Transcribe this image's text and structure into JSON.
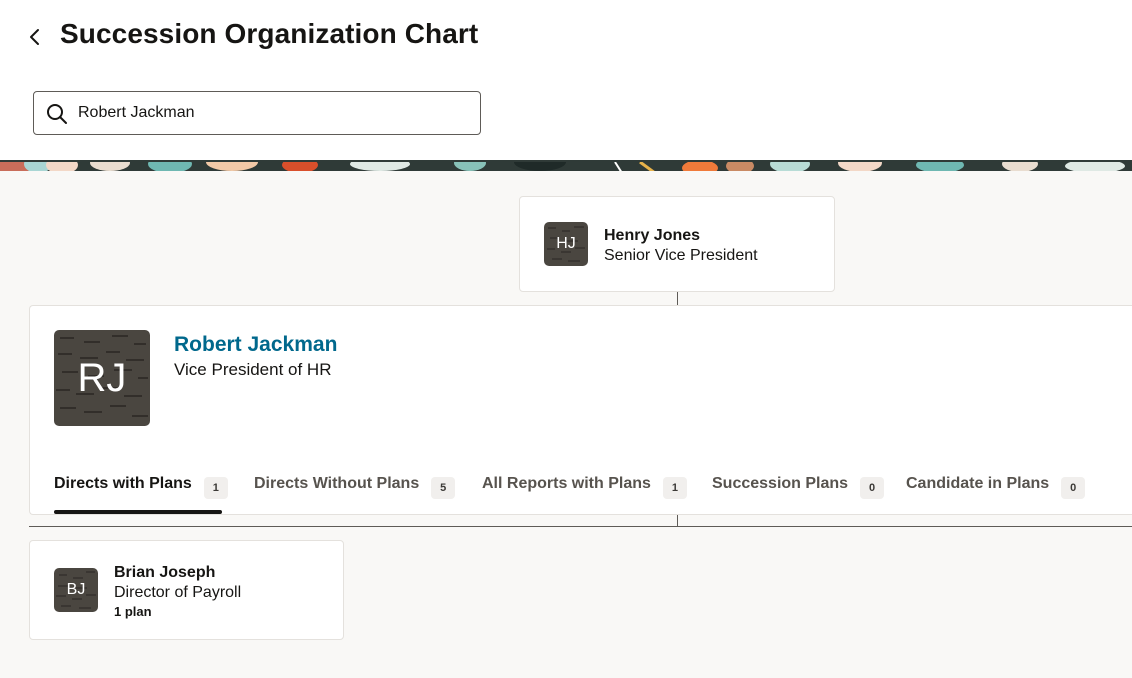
{
  "header": {
    "title": "Succession Organization Chart"
  },
  "search": {
    "value": "Robert Jackman",
    "placeholder": ""
  },
  "manager": {
    "initials": "HJ",
    "name": "Henry Jones",
    "title": "Senior Vice President"
  },
  "focus": {
    "initials": "RJ",
    "name": "Robert Jackman",
    "title": "Vice President of HR",
    "tabs": [
      {
        "label": "Directs with Plans",
        "count": "1",
        "active": true
      },
      {
        "label": "Directs Without Plans",
        "count": "5",
        "active": false
      },
      {
        "label": "All Reports with Plans",
        "count": "1",
        "active": false
      },
      {
        "label": "Succession Plans",
        "count": "0",
        "active": false
      },
      {
        "label": "Candidate in Plans",
        "count": "0",
        "active": false
      }
    ]
  },
  "reports": [
    {
      "initials": "BJ",
      "name": "Brian Joseph",
      "title": "Director of Payroll",
      "plans": "1 plan"
    }
  ],
  "colors": {
    "link": "#00688c",
    "text": "#161513",
    "avatar_bg": "#4a4640",
    "page_bg": "#f9f8f6"
  }
}
